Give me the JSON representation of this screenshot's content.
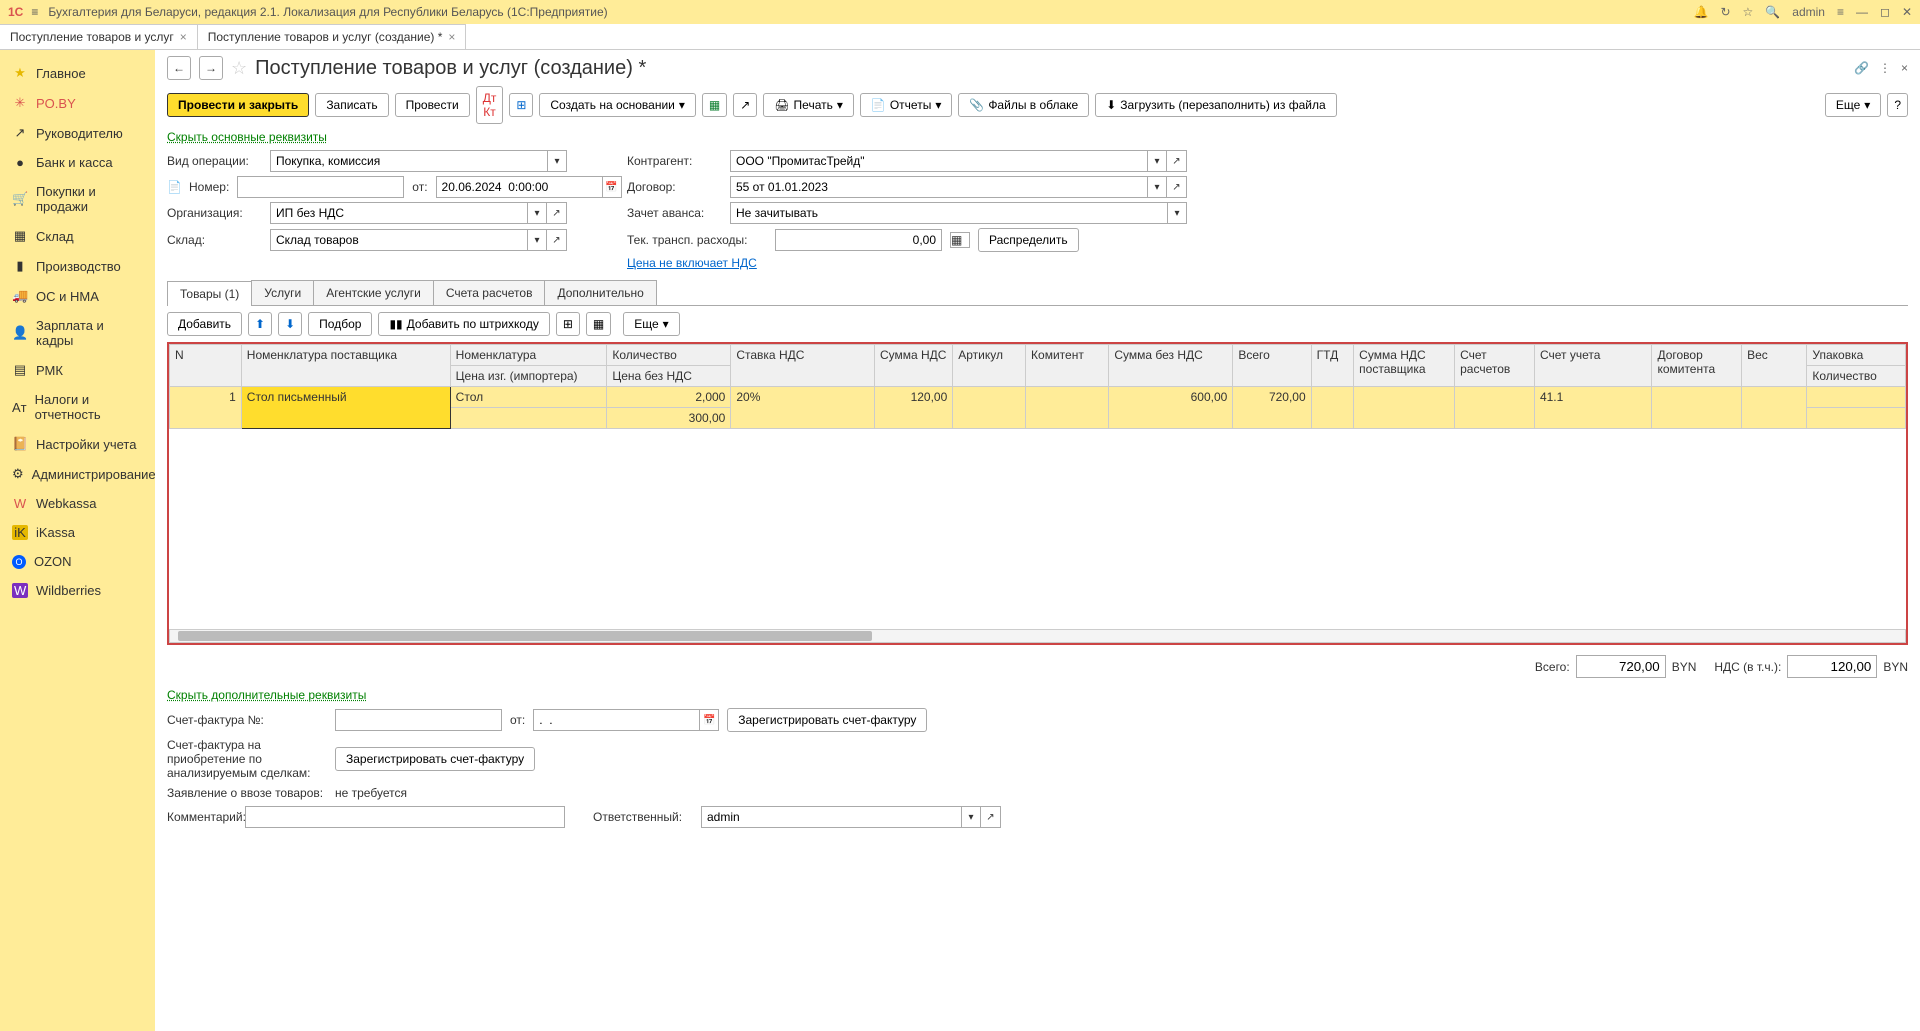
{
  "titlebar": {
    "app": "1С",
    "title": "Бухгалтерия для Беларуси, редакция 2.1. Локализация для Республики Беларусь   (1С:Предприятие)",
    "user": "admin"
  },
  "tabs": [
    {
      "label": "Поступление товаров и услуг"
    },
    {
      "label": "Поступление товаров и услуг (создание) *"
    }
  ],
  "sidebar": [
    {
      "icon": "★",
      "label": "Главное",
      "color": "#e6b800"
    },
    {
      "icon": "✳",
      "label": "PO.BY",
      "color": "#d9534f"
    },
    {
      "icon": "↗",
      "label": "Руководителю",
      "color": "#333"
    },
    {
      "icon": "●",
      "label": "Банк и касса",
      "color": "#333"
    },
    {
      "icon": "🛒",
      "label": "Покупки и продажи",
      "color": "#333"
    },
    {
      "icon": "▦",
      "label": "Склад",
      "color": "#333"
    },
    {
      "icon": "▮",
      "label": "Производство",
      "color": "#333"
    },
    {
      "icon": "🚚",
      "label": "ОС и НМА",
      "color": "#333"
    },
    {
      "icon": "👤",
      "label": "Зарплата и кадры",
      "color": "#333"
    },
    {
      "icon": "▤",
      "label": "РМК",
      "color": "#333"
    },
    {
      "icon": "Aᴛ",
      "label": "Налоги и отчетность",
      "color": "#333"
    },
    {
      "icon": "📔",
      "label": "Настройки учета",
      "color": "#333"
    },
    {
      "icon": "⚙",
      "label": "Администрирование",
      "color": "#333"
    },
    {
      "icon": "W",
      "label": "Webkassa",
      "color": "#d9534f"
    },
    {
      "icon": "iK",
      "label": "iKassa",
      "color": "#e6b800"
    },
    {
      "icon": "O",
      "label": "OZON",
      "color": "#005bff"
    },
    {
      "icon": "W",
      "label": "Wildberries",
      "color": "#7b2fbf"
    }
  ],
  "page": {
    "title": "Поступление товаров и услуг (создание) *"
  },
  "actions": {
    "post_close": "Провести и закрыть",
    "write": "Записать",
    "post": "Провести",
    "create_based": "Создать на основании",
    "print": "Печать",
    "reports": "Отчеты",
    "files_cloud": "Файлы в облаке",
    "load_file": "Загрузить (перезаполнить) из файла",
    "more": "Еще"
  },
  "links": {
    "hide_main": "Скрыть основные реквизиты",
    "price_vat": "Цена не включает НДС",
    "hide_extra": "Скрыть дополнительные реквизиты"
  },
  "form": {
    "operation_label": "Вид операции:",
    "operation": "Покупка, комиссия",
    "number_label": "Номер:",
    "number": "",
    "date_label": "от:",
    "date": "20.06.2024  0:00:00",
    "org_label": "Организация:",
    "org": "ИП без НДС",
    "warehouse_label": "Склад:",
    "warehouse": "Склад товаров",
    "counterparty_label": "Контрагент:",
    "counterparty": "ООО \"ПромитасТрейд\"",
    "contract_label": "Договор:",
    "contract": "55 от 01.01.2023",
    "advance_label": "Зачет аванса:",
    "advance": "Не зачитывать",
    "transport_label": "Тек. трансп. расходы:",
    "transport": "0,00",
    "distribute": "Распределить"
  },
  "tabs2": {
    "goods": "Товары (1)",
    "services": "Услуги",
    "agent": "Агентские услуги",
    "accounts": "Счета расчетов",
    "extra": "Дополнительно"
  },
  "table_toolbar": {
    "add": "Добавить",
    "select": "Подбор",
    "barcode": "Добавить по штрихкоду",
    "more": "Еще"
  },
  "table": {
    "headers": {
      "n": "N",
      "supplier_nom": "Номенклатура поставщика",
      "nom": "Номенклатура",
      "importer_price": "Цена изг. (импортера)",
      "qty": "Количество",
      "price_no_vat": "Цена без НДС",
      "vat_rate": "Ставка НДС",
      "vat_sum": "Сумма НДС",
      "article": "Артикул",
      "committent": "Комитент",
      "sum_no_vat": "Сумма без НДС",
      "total": "Всего",
      "g": "ГТД",
      "supplier_vat": "Сумма НДС поставщика",
      "calc_account": "Счет расчетов",
      "account": "Счет учета",
      "committent_contract": "Договор комитента",
      "weight": "Вес",
      "package": "Упаковка",
      "qty2": "Количество"
    },
    "rows": [
      {
        "n": "1",
        "supplier_nom": "Стол письменный",
        "nom": "Стол",
        "qty": "2,000",
        "price_no_vat": "300,00",
        "vat_rate": "20%",
        "vat_sum": "120,00",
        "sum_no_vat": "600,00",
        "total": "720,00",
        "account": "41.1"
      }
    ]
  },
  "totals": {
    "total_label": "Всего:",
    "total": "720,00",
    "currency": "BYN",
    "vat_label": "НДС (в т.ч.):",
    "vat": "120,00"
  },
  "footer": {
    "invoice_label": "Счет-фактура №:",
    "invoice_date_label": "от:",
    "invoice_date": ".  .",
    "register_invoice": "Зарегистрировать счет-фактуру",
    "purchase_invoice_label": "Счет-фактура на приобретение по анализируемым сделкам:",
    "import_label": "Заявление о ввозе товаров:",
    "import_value": "не требуется",
    "comment_label": "Комментарий:",
    "responsible_label": "Ответственный:",
    "responsible": "admin"
  }
}
